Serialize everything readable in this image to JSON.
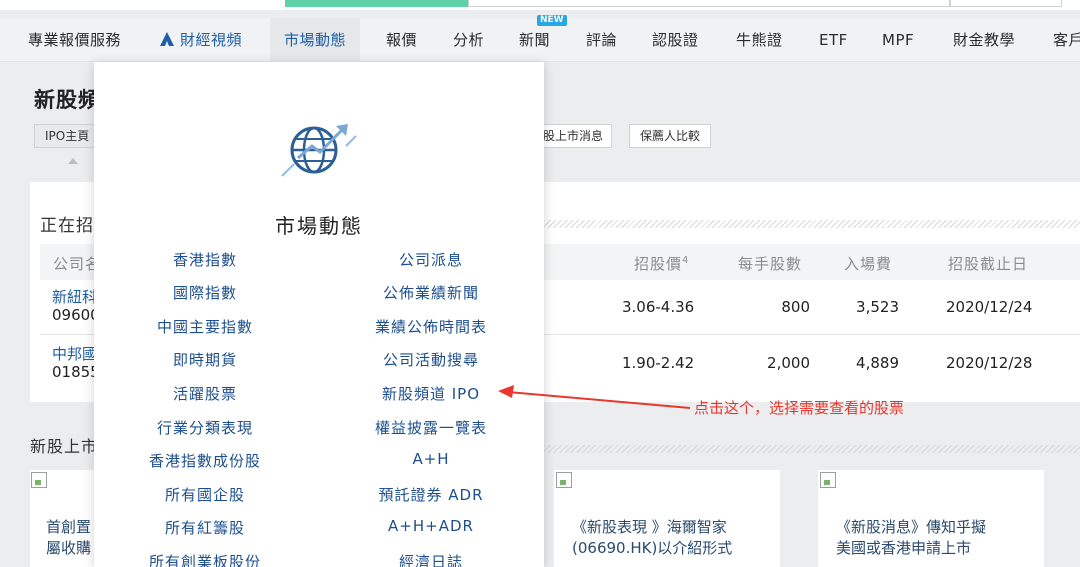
{
  "nav": {
    "items": [
      "專業報價服務",
      "財經視頻",
      "市場動態",
      "報價",
      "分析",
      "新聞",
      "評論",
      "認股證",
      "牛熊證",
      "ETF",
      "MPF",
      "財金教學",
      "客戶"
    ],
    "new_badge": "NEW"
  },
  "page": {
    "title": "新股頻",
    "subtabs": [
      "IPO主頁",
      "股上市消息",
      "保薦人比較"
    ]
  },
  "ipo_section": {
    "heading": "正在招",
    "columns": [
      "公司名",
      "招股價",
      "4",
      "每手股數",
      "入場費",
      "招股截止日"
    ],
    "rows": [
      {
        "name": "新紐科",
        "code": "09600",
        "price": "3.06-4.36",
        "lot": "800",
        "fee": "3,523",
        "deadline": "2020/12/24"
      },
      {
        "name": "中邦國",
        "code": "01855",
        "price": "1.90-2.42",
        "lot": "2,000",
        "fee": "4,889",
        "deadline": "2020/12/28"
      }
    ]
  },
  "news_section": {
    "heading": "新股上市",
    "cards": [
      {
        "text": "首創置\n屬收購\n..."
      },
      {
        "text": "《新股表現 》海爾智家\n(06690.HK)以介紹形式\n..."
      },
      {
        "text": "《新股消息》傳知乎擬\n美國或香港申請上市"
      }
    ]
  },
  "dropdown": {
    "title": "市場動態",
    "left_items": [
      "香港指數",
      "國際指數",
      "中國主要指數",
      "即時期貨",
      "活躍股票",
      "行業分類表現",
      "香港指數成份股",
      "所有國企股",
      "所有紅籌股",
      "所有創業板股份"
    ],
    "right_items": [
      "公司派息",
      "公佈業績新聞",
      "業績公佈時間表",
      "公司活動搜尋",
      "新股頻道 IPO",
      "權益披露一覽表",
      "A+H",
      "預託證券 ADR",
      "A+H+ADR",
      "經濟日誌"
    ]
  },
  "annotation": {
    "text": "点击这个，选择需要查看的股票",
    "color": "#e8372c"
  },
  "colors": {
    "accent": "#1d5ea8",
    "nav_bg": "#f1f2f4",
    "page_bg": "#ecedef"
  }
}
